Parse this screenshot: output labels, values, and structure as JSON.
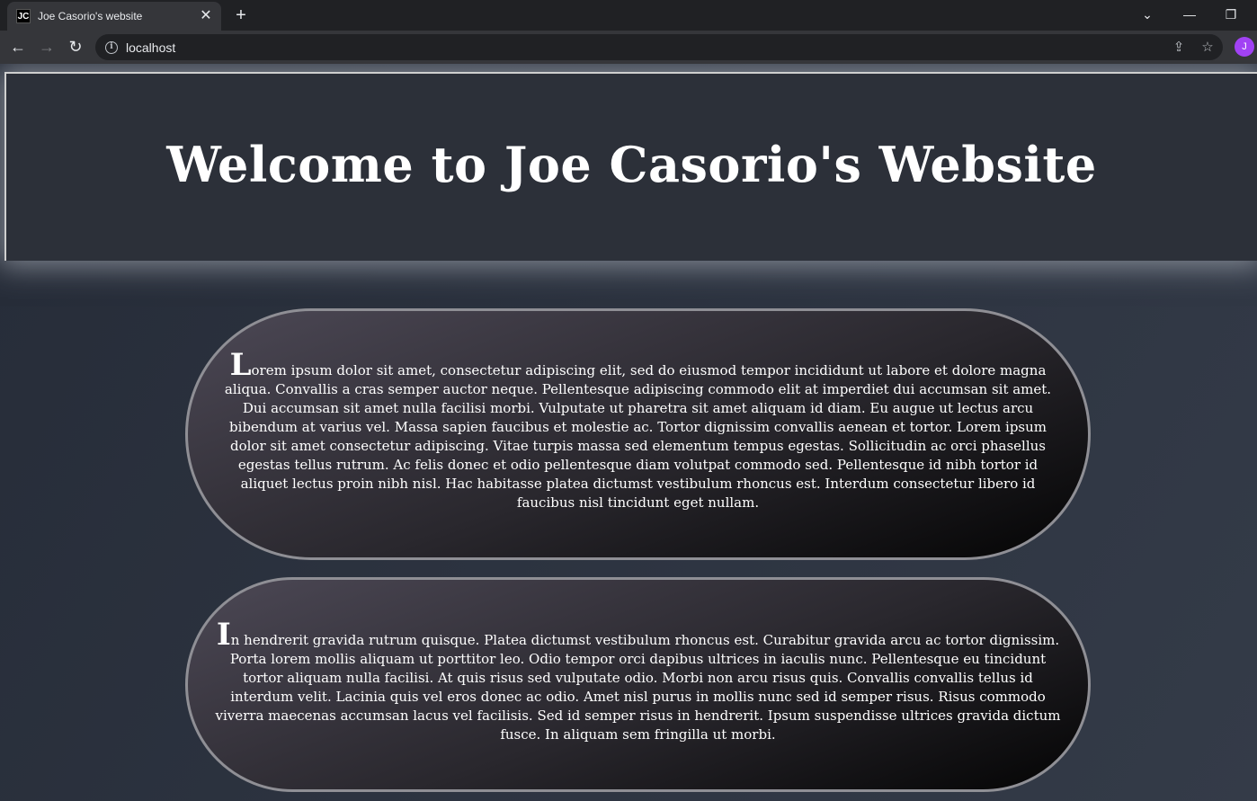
{
  "browser": {
    "tab_icon_text": "JC",
    "tab_title": "Joe Casorio's website",
    "url": "localhost",
    "avatar_initial": "J"
  },
  "header": {
    "title": "Welcome to Joe Casorio's Website"
  },
  "paragraphs": [
    {
      "dropcap": "L",
      "text": "orem ipsum dolor sit amet, consectetur adipiscing elit, sed do eiusmod tempor incididunt ut labore et dolore magna aliqua. Convallis a cras semper auctor neque. Pellentesque adipiscing commodo elit at imperdiet dui accumsan sit amet. Dui accumsan sit amet nulla facilisi morbi. Vulputate ut pharetra sit amet aliquam id diam. Eu augue ut lectus arcu bibendum at varius vel. Massa sapien faucibus et molestie ac. Tortor dignissim convallis aenean et tortor. Lorem ipsum dolor sit amet consectetur adipiscing. Vitae turpis massa sed elementum tempus egestas. Sollicitudin ac orci phasellus egestas tellus rutrum. Ac felis donec et odio pellentesque diam volutpat commodo sed. Pellentesque id nibh tortor id aliquet lectus proin nibh nisl. Hac habitasse platea dictumst vestibulum rhoncus est. Interdum consectetur libero id faucibus nisl tincidunt eget nullam."
    },
    {
      "dropcap": "I",
      "text": "n hendrerit gravida rutrum quisque. Platea dictumst vestibulum rhoncus est. Curabitur gravida arcu ac tortor dignissim. Porta lorem mollis aliquam ut porttitor leo. Odio tempor orci dapibus ultrices in iaculis nunc. Pellentesque eu tincidunt tortor aliquam nulla facilisi. At quis risus sed vulputate odio. Morbi non arcu risus quis. Convallis convallis tellus id interdum velit. Lacinia quis vel eros donec ac odio. Amet nisl purus in mollis nunc sed id semper risus. Risus commodo viverra maecenas accumsan lacus vel facilisis. Sed id semper risus in hendrerit. Ipsum suspendisse ultrices gravida dictum fusce. In aliquam sem fringilla ut morbi."
    }
  ]
}
